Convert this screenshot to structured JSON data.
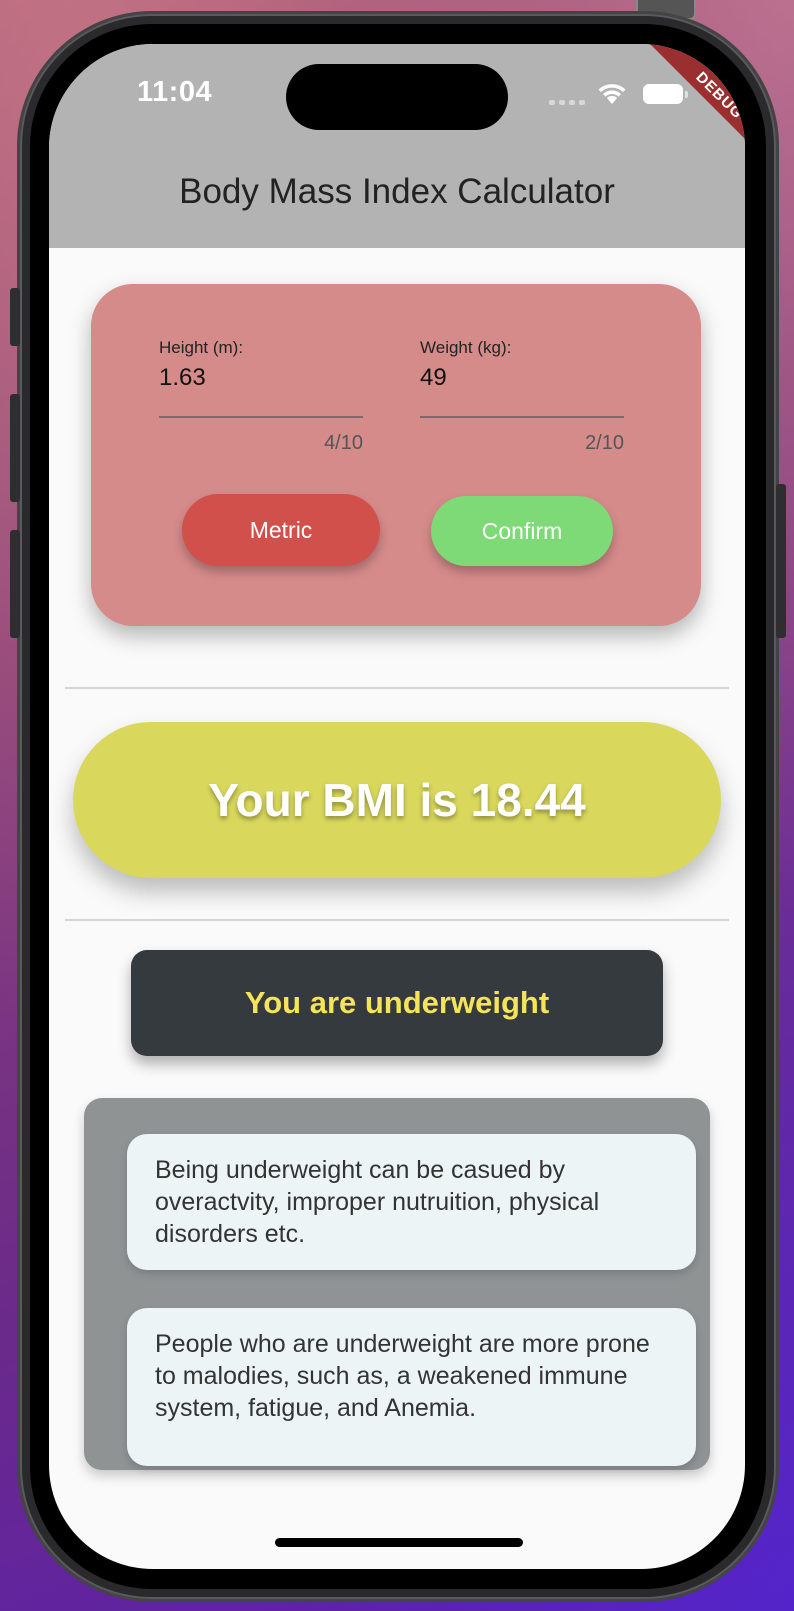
{
  "status_bar": {
    "time": "11:04"
  },
  "debug_banner": "DEBUG",
  "app_bar": {
    "title": "Body Mass Index Calculator"
  },
  "inputs": {
    "height": {
      "label": "Height (m):",
      "value": "1.63",
      "counter": "4/10"
    },
    "weight": {
      "label": "Weight (kg):",
      "value": "49",
      "counter": "2/10"
    }
  },
  "buttons": {
    "metric": "Metric",
    "confirm": "Confirm"
  },
  "result": {
    "bmi_text": "Your BMI is 18.44",
    "bmi_value": 18.44
  },
  "category": {
    "text": "You are underweight"
  },
  "info": [
    {
      "text": "Being underweight can be casued by overactvity, improper nutruition, physical disorders etc."
    },
    {
      "text": "People who are underweight are more prone to malodies, such as, a weakened immune system, fatigue, and Anemia."
    }
  ],
  "colors": {
    "app_bar": "#b3b3b3",
    "input_card": "#d68b8b",
    "metric_button": "#d1504c",
    "confirm_button": "#7ed977",
    "bmi_pill": "#d9d85c",
    "status_box": "#343a3d",
    "status_text": "#f5e35a",
    "info_panel": "#8f9394",
    "info_card": "#edf4f6"
  }
}
